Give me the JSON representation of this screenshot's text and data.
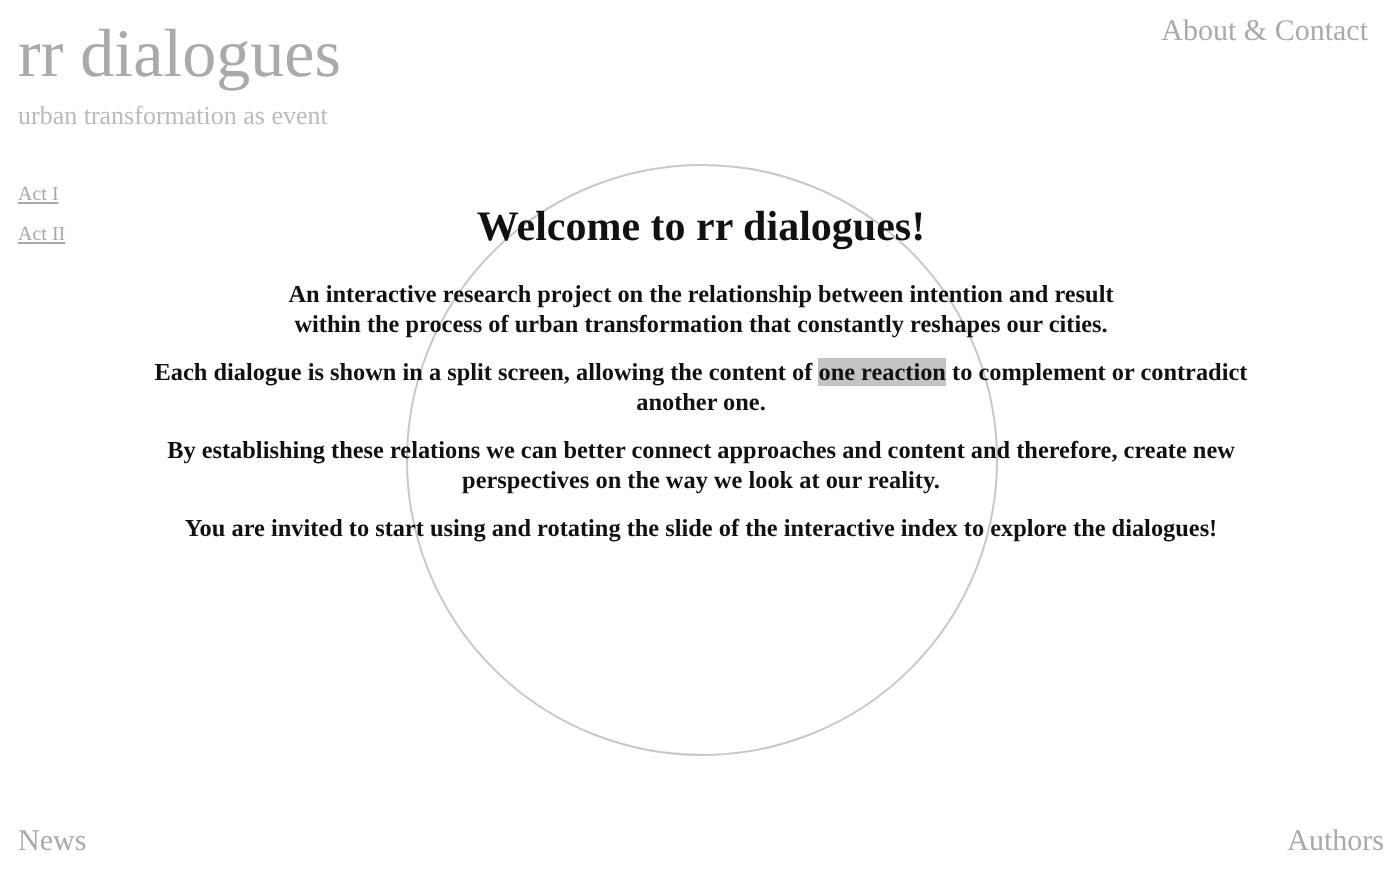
{
  "header": {
    "title": "rr dialogues",
    "subtitle": "urban transformation as event",
    "about_link": "About & Contact"
  },
  "acts": [
    "Act I",
    "Act II"
  ],
  "intro": {
    "heading": "Welcome to rr dialogues!",
    "paragraphs": [
      [
        {
          "text": "An interactive research project on the relationship between intention and result",
          "highlighted": false
        }
      ],
      [
        {
          "text": "within the process of urban transformation that constantly reshapes our cities.",
          "highlighted": false
        }
      ],
      [
        {
          "text": "Each dialogue is shown in a split screen, allowing the content of ",
          "highlighted": false
        },
        {
          "text": "one reaction",
          "highlighted": true
        },
        {
          "text": " to complement or contradict another one.",
          "highlighted": false
        }
      ],
      [
        {
          "text": "By establishing these relations we can better connect approaches and content and therefore, create new perspectives on the way we look at our reality.",
          "highlighted": false
        }
      ],
      [
        {
          "text": "You are invited to start using and rotating the slide of the interactive index to explore the dialogues!",
          "highlighted": false
        }
      ]
    ]
  },
  "footer": {
    "left_link": "News",
    "right_link": "Authors"
  }
}
